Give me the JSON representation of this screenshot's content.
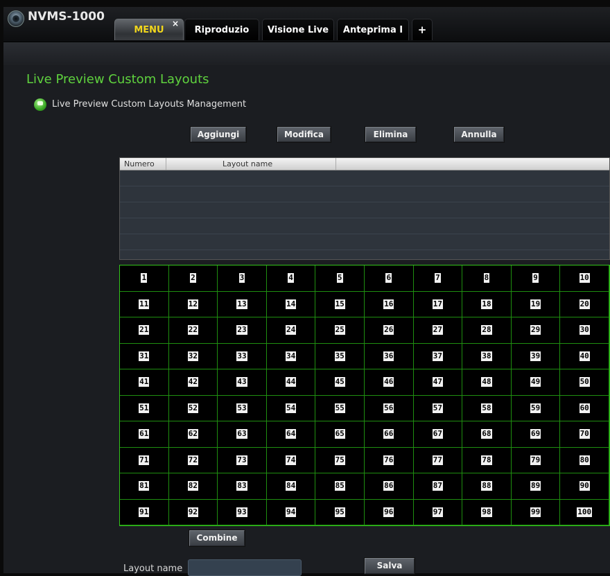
{
  "app": {
    "title": "NVMS-1000"
  },
  "tabs": [
    {
      "label": "MENU",
      "close": "×",
      "active": true
    },
    {
      "label": "Riproduzio"
    },
    {
      "label": "Visione Live"
    },
    {
      "label": "Anteprima I"
    },
    {
      "label": "+"
    }
  ],
  "page": {
    "title": "Live Preview Custom Layouts",
    "section_title": "Live Preview Custom Layouts Management"
  },
  "toolbar": {
    "add": "Aggiungi",
    "modify": "Modifica",
    "delete": "Elimina",
    "cancel": "Annulla"
  },
  "table": {
    "columns": [
      "Numero",
      "Layout name"
    ],
    "rows": []
  },
  "grid": {
    "cells": [
      1,
      2,
      3,
      4,
      5,
      6,
      7,
      8,
      9,
      10,
      11,
      12,
      13,
      14,
      15,
      16,
      17,
      18,
      19,
      20,
      21,
      22,
      23,
      24,
      25,
      26,
      27,
      28,
      29,
      30,
      31,
      32,
      33,
      34,
      35,
      36,
      37,
      38,
      39,
      40,
      41,
      42,
      43,
      44,
      45,
      46,
      47,
      48,
      49,
      50,
      51,
      52,
      53,
      54,
      55,
      56,
      57,
      58,
      59,
      60,
      61,
      62,
      63,
      64,
      65,
      66,
      67,
      68,
      69,
      70,
      71,
      72,
      73,
      74,
      75,
      76,
      77,
      78,
      79,
      80,
      81,
      82,
      83,
      84,
      85,
      86,
      87,
      88,
      89,
      90,
      91,
      92,
      93,
      94,
      95,
      96,
      97,
      98,
      99,
      100
    ]
  },
  "form": {
    "combine": "Combine",
    "layout_name_label": "Layout name",
    "layout_name_value": "",
    "save": "Salva"
  },
  "colors": {
    "accent_green": "#5fd23e",
    "grid_line": "#33c21a",
    "active_tab_text": "#f2d71c"
  }
}
